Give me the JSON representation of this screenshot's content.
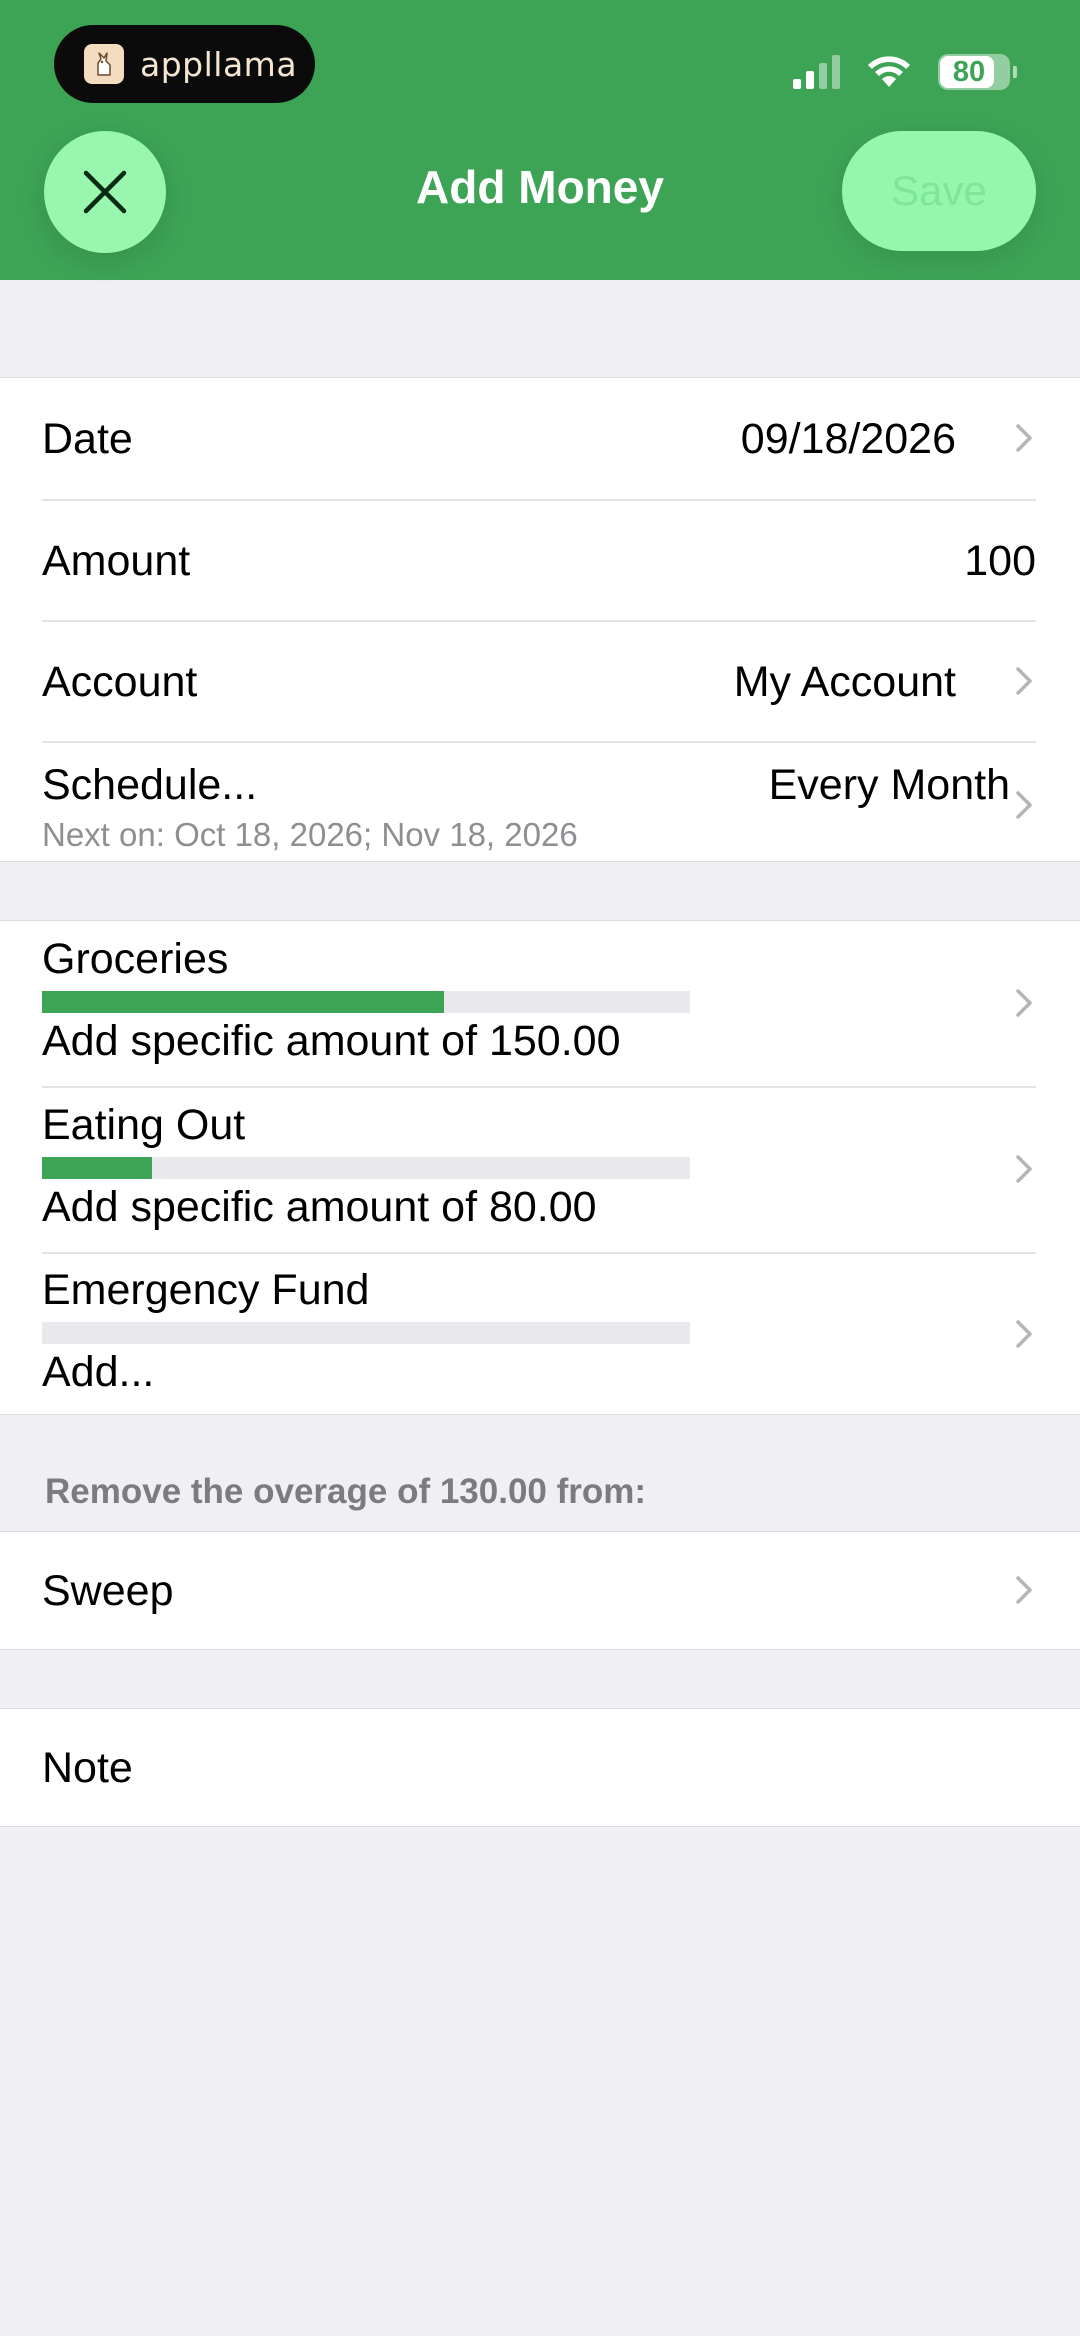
{
  "status_bar": {
    "app_pill_label": "appllama",
    "battery_level": "80",
    "battery_fraction": 0.8
  },
  "header": {
    "title": "Add Money",
    "save_label": "Save",
    "close_icon": "close-icon"
  },
  "details": {
    "date": {
      "label": "Date",
      "value": "09/18/2026"
    },
    "amount": {
      "label": "Amount",
      "value": "100"
    },
    "account": {
      "label": "Account",
      "value": "My Account"
    },
    "schedule": {
      "label": "Schedule...",
      "value": "Every Month",
      "next": "Next on: Oct 18, 2026; Nov 18, 2026"
    }
  },
  "envelopes": [
    {
      "name": "Groceries",
      "fill_fraction": 0.62,
      "action": "Add specific amount of 150.00"
    },
    {
      "name": "Eating Out",
      "fill_fraction": 0.17,
      "action": "Add specific amount of 80.00"
    },
    {
      "name": "Emergency Fund",
      "fill_fraction": 0.0,
      "action": "Add..."
    }
  ],
  "overage": {
    "caption": "Remove the overage of 130.00 from:",
    "target": "Sweep"
  },
  "note": {
    "label": "Note"
  },
  "colors": {
    "brand_green": "#3da456",
    "button_mint": "#98f6ae",
    "background": "#efeff4"
  }
}
